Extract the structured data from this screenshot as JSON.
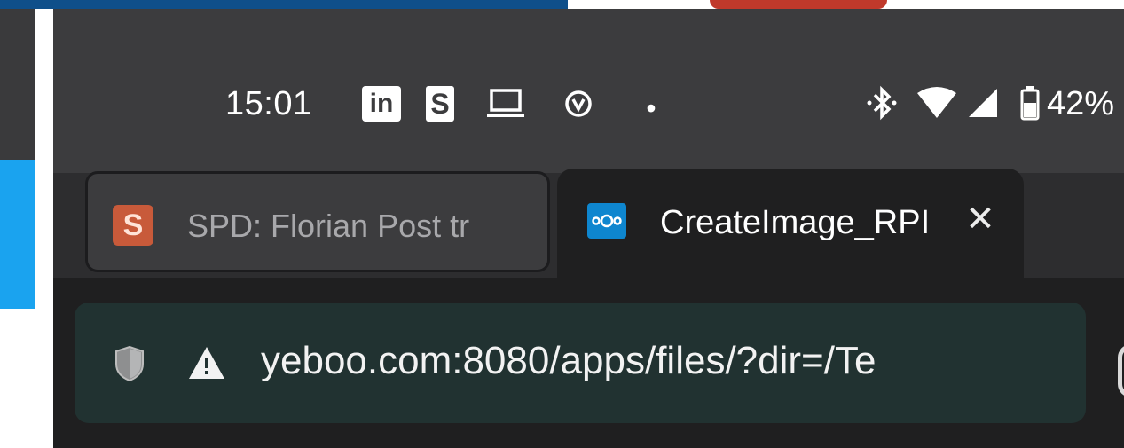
{
  "statusbar": {
    "time": "15:01",
    "linkedin_label": "in",
    "s_label": "S",
    "dot": "•",
    "battery_percent": "42%"
  },
  "tabs": [
    {
      "favicon_letter": "S",
      "title": "SPD: Florian Post tr",
      "active": false
    },
    {
      "title": "CreateImage_RPI",
      "active": true,
      "close_symbol": "✕"
    }
  ],
  "omnibox": {
    "url": "yeboo.com:8080/apps/files/?dir=/Te"
  },
  "colors": {
    "statusbar_bg": "#3c3c3e",
    "toolbar_bg": "#1f1f20",
    "omnibox_bg": "#213231",
    "spd_favicon": "#c85a3a",
    "nextcloud_favicon": "#0e86cf"
  }
}
